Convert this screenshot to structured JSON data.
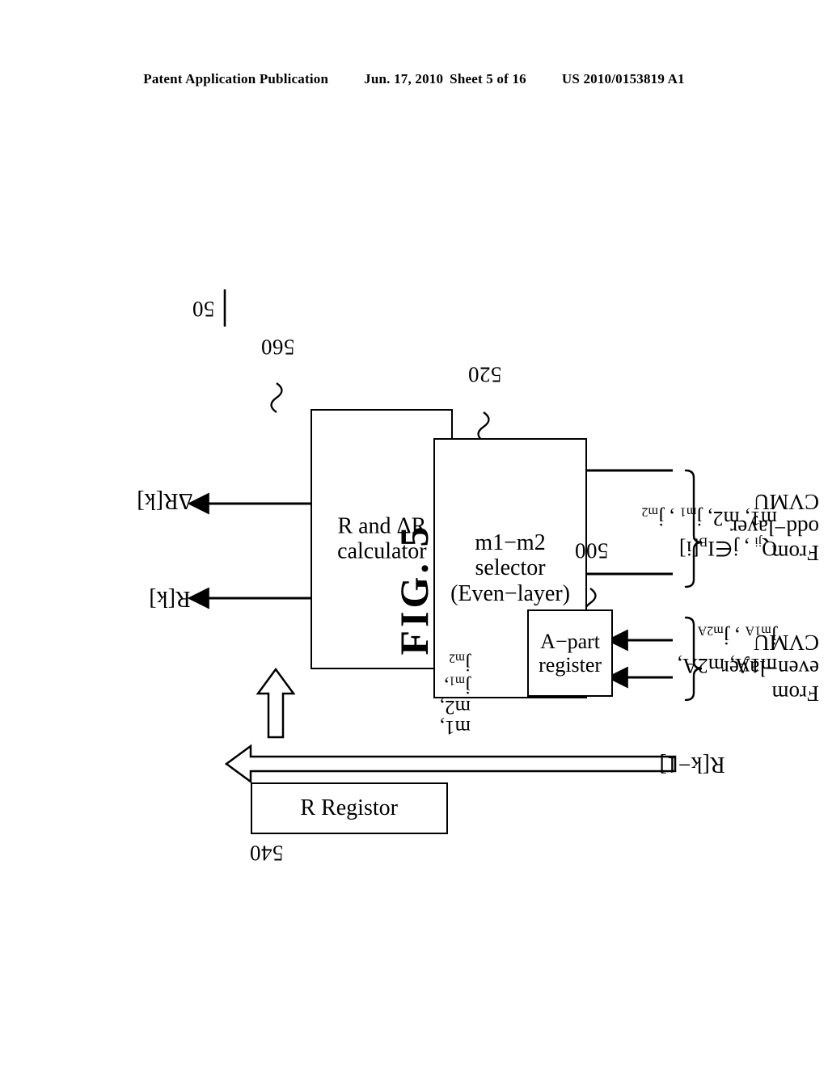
{
  "header": {
    "publication": "Patent Application Publication",
    "date": "Jun. 17, 2010",
    "sheet": "Sheet 5 of 16",
    "patent_number": "US 2010/0153819 A1"
  },
  "figure": {
    "label": "FIG. 5",
    "system_numeral": "50"
  },
  "blocks": [
    {
      "id": "r_register",
      "label": "R Registor",
      "numeral": "540"
    },
    {
      "id": "calculator",
      "label": "R and ΔR\ncalculator",
      "numeral": "560"
    },
    {
      "id": "selector",
      "label": "m1−m2\nselector\n(Even−layer)",
      "numeral": "520"
    },
    {
      "id": "a_part_reg",
      "label": "A−part\nregister",
      "numeral": "500"
    }
  ],
  "outputs": [
    {
      "id": "out_r",
      "label": "R[k]"
    },
    {
      "id": "out_delta_r",
      "label": "ΔR[k]"
    }
  ],
  "signals": {
    "feedback_input": "R[k−1]",
    "selector_to_mux": "m1,\nm2,\njₘ₁,\njₘ₂",
    "selector_to_mux_lines": [
      "m1,",
      "m2,",
      "j",
      "j"
    ],
    "selector_to_mux_subs": [
      "",
      "",
      "m1",
      "m2"
    ],
    "even_layer_line1": "m1A, m2A,",
    "even_layer_line2": "jₘ₁ᴀ , jₘ₂ᴀ",
    "odd_layer_line1": "Qⱼᵢ , j∈Iʙ[i]",
    "odd_layer_line2": "m1, m2, jₘ₁ , jₘ₂"
  },
  "sources": [
    {
      "id": "even_layer_source",
      "lines": [
        "From",
        "even−layer",
        "CVMU"
      ]
    },
    {
      "id": "odd_layer_source",
      "lines": [
        "From",
        "odd−layer",
        "CVMU"
      ]
    }
  ],
  "colors": {
    "ink": "#000000",
    "paper": "#ffffff"
  }
}
